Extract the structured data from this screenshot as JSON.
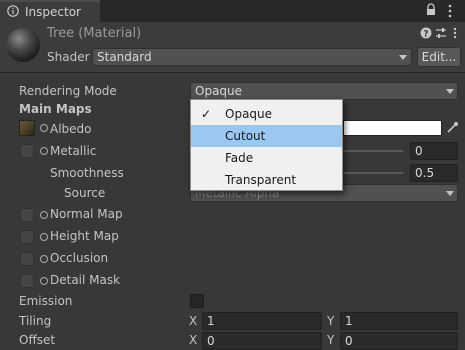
{
  "tab": {
    "label": "Inspector"
  },
  "header": {
    "title": "Tree (Material)",
    "shader_label": "Shader",
    "shader_value": "Standard",
    "edit_label": "Edit..."
  },
  "rendering_mode": {
    "label": "Rendering Mode",
    "value": "Opaque"
  },
  "main_maps": {
    "heading": "Main Maps",
    "albedo": "Albedo",
    "metallic": "Metallic",
    "metallic_value": "0",
    "smoothness": "Smoothness",
    "smoothness_value": "0.5",
    "source": "Source",
    "source_value": "Metallic Alpha",
    "normal_map": "Normal Map",
    "height_map": "Height Map",
    "occlusion": "Occlusion",
    "detail_mask": "Detail Mask"
  },
  "emission": {
    "label": "Emission"
  },
  "tiling": {
    "label": "Tiling",
    "x_label": "X",
    "x_value": "1",
    "y_label": "Y",
    "y_value": "1"
  },
  "offset": {
    "label": "Offset",
    "x_label": "X",
    "x_value": "0",
    "y_label": "Y",
    "y_value": "0"
  },
  "dropdown_menu": {
    "items": [
      {
        "label": "Opaque",
        "checked": true
      },
      {
        "label": "Cutout",
        "highlighted": true
      },
      {
        "label": "Fade"
      },
      {
        "label": "Transparent"
      }
    ],
    "check_glyph": "✓"
  },
  "colors": {
    "highlight": "#9ac8f0",
    "panel": "#383838",
    "popup_bg": "#f0f0f0"
  }
}
